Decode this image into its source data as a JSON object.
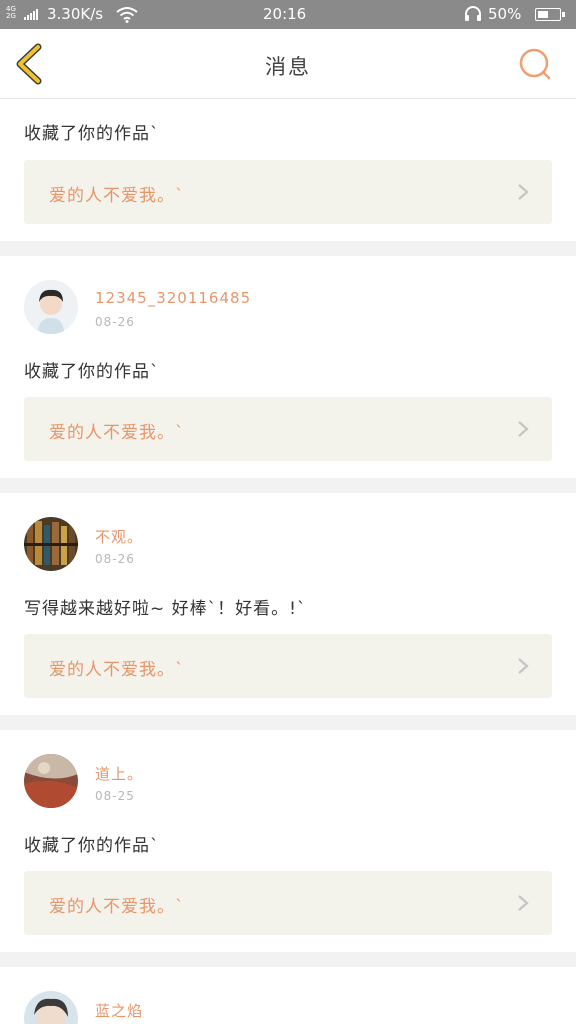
{
  "status_bar": {
    "network_top": "4G",
    "network_bottom": "2G",
    "speed": "3.30K/s",
    "time": "20:16",
    "battery": "50%"
  },
  "header": {
    "title": "消息"
  },
  "colors": {
    "accent": "#e8956a",
    "back_icon": "#f0c22e",
    "card_bg": "#f3f3ec"
  },
  "icons": [
    "chevron-left-icon",
    "search-icon",
    "chevron-right-icon",
    "wifi-icon",
    "headset-icon",
    "battery-icon"
  ],
  "messages": [
    {
      "content": "收藏了你的作品`",
      "work_title": "爱的人不爱我。`"
    },
    {
      "username": "12345_320116485",
      "date": "08-26",
      "content": "收藏了你的作品`",
      "work_title": "爱的人不爱我。`"
    },
    {
      "username": "不观。",
      "date": "08-26",
      "content": "写得越来越好啦~ 好棒`！好看。!`",
      "work_title": "爱的人不爱我。`"
    },
    {
      "username": "道上。",
      "date": "08-25",
      "content": "收藏了你的作品`",
      "work_title": "爱的人不爱我。`"
    },
    {
      "username": "蓝之焰"
    }
  ]
}
